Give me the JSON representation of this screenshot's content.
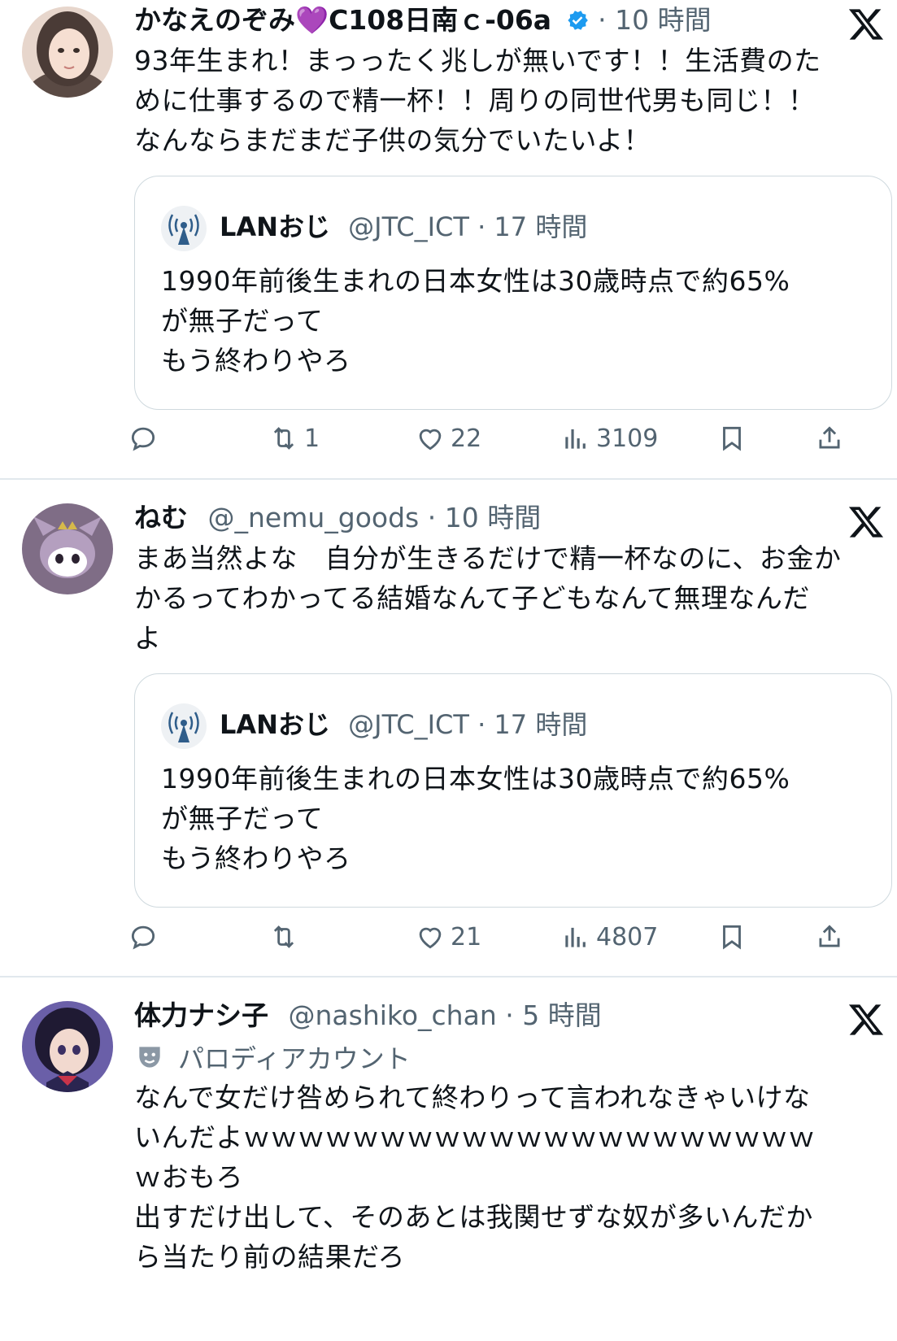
{
  "tweets": [
    {
      "name": "かなえのぞみ💜C108日南ｃ-06a",
      "verified": true,
      "handle": "",
      "dot": "·",
      "time": "10 時間",
      "text": "93年生まれ！まっったく兆しが無いです！！生活費のた\nめに仕事するので精一杯！！周りの同世代男も同じ！！\nなんならまだまだ子供の気分でいたいよ！",
      "quote": {
        "name": "LANおじ",
        "handle": "@JTC_ICT",
        "dot": "·",
        "time": "17 時間",
        "text": "1990年前後生まれの日本女性は30歳時点で約65%\nが無子だって\nもう終わりやろ"
      },
      "stats": {
        "retweets": "1",
        "likes": "22",
        "views": "3109"
      }
    },
    {
      "name": "ねむ",
      "verified": false,
      "handle": "@_nemu_goods",
      "dot": "·",
      "time": "10 時間",
      "text": "まあ当然よな　自分が生きるだけで精一杯なのに、お金か\nかるってわかってる結婚なんて子どもなんて無理なんだ\nよ",
      "quote": {
        "name": "LANおじ",
        "handle": "@JTC_ICT",
        "dot": "·",
        "time": "17 時間",
        "text": "1990年前後生まれの日本女性は30歳時点で約65%\nが無子だって\nもう終わりやろ"
      },
      "stats": {
        "retweets": "",
        "likes": "21",
        "views": "4807"
      }
    },
    {
      "name": "体力ナシ子",
      "verified": false,
      "handle": "@nashiko_chan",
      "dot": "·",
      "time": "5 時間",
      "parody_label": "パロディアカウント",
      "text": "なんで女だけ咎められて終わりって言われなきゃいけな\nいんだよｗｗｗｗｗｗｗｗｗｗｗｗｗｗｗｗｗｗｗｗｗ\nｗおもろ\n出すだけ出して、そのあとは我関せずな奴が多いんだか\nら当たり前の結果だろ"
    }
  ],
  "colors": {
    "text": "#0f1419",
    "secondary": "#536471",
    "verified": "#1d9bf0",
    "border": "#cfd9de"
  }
}
